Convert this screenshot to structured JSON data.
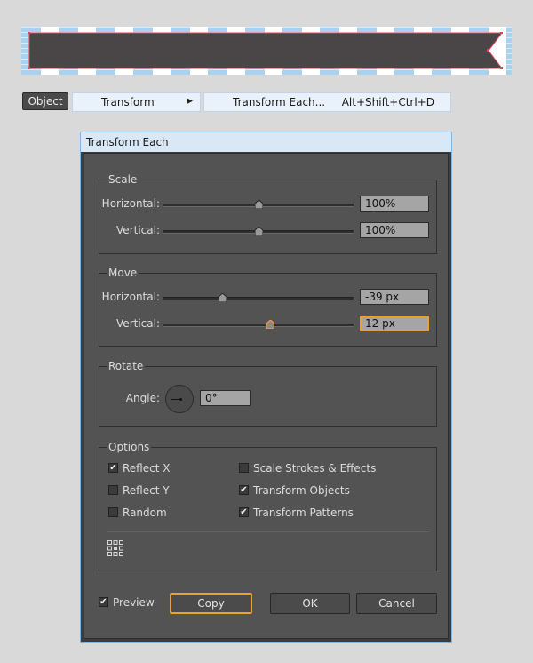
{
  "menu": {
    "object_label": "Object",
    "transform_label": "Transform",
    "submenu_arrow": "▶",
    "transform_each_label": "Transform Each...",
    "transform_each_shortcut": "Alt+Shift+Ctrl+D"
  },
  "dialog": {
    "title": "Transform Each",
    "scale": {
      "title": "Scale",
      "horizontal_label": "Horizontal:",
      "horizontal_value": "100%",
      "horizontal_level": 0.5,
      "vertical_label": "Vertical:",
      "vertical_value": "100%",
      "vertical_level": 0.5
    },
    "move": {
      "title": "Move",
      "horizontal_label": "Horizontal:",
      "horizontal_value": "-39 px",
      "horizontal_level": 0.31,
      "vertical_label": "Vertical:",
      "vertical_value": "12 px",
      "vertical_level": 0.56
    },
    "rotate": {
      "title": "Rotate",
      "angle_label": "Angle:",
      "angle_value": "0°"
    },
    "options": {
      "title": "Options",
      "reflect_x": {
        "label": "Reflect X",
        "checked": true
      },
      "reflect_y": {
        "label": "Reflect Y",
        "checked": false
      },
      "random": {
        "label": "Random",
        "checked": false
      },
      "scale_strokes": {
        "label": "Scale Strokes & Effects",
        "checked": false
      },
      "transform_objects": {
        "label": "Transform Objects",
        "checked": true
      },
      "transform_patterns": {
        "label": "Transform Patterns",
        "checked": true
      }
    },
    "preview": {
      "label": "Preview",
      "checked": true
    },
    "buttons": {
      "copy": "Copy",
      "ok": "OK",
      "cancel": "Cancel"
    }
  },
  "colors": {
    "accent": "#f0a02e",
    "dialog_bg": "#535353",
    "ribbon": "#4a4546",
    "selection": "#e8405a"
  },
  "icons": {
    "submenu": "submenu-arrow-icon",
    "reference_point": "reference-point-icon",
    "checkmark": "checkmark-icon",
    "angle_dial": "angle-dial-icon"
  }
}
